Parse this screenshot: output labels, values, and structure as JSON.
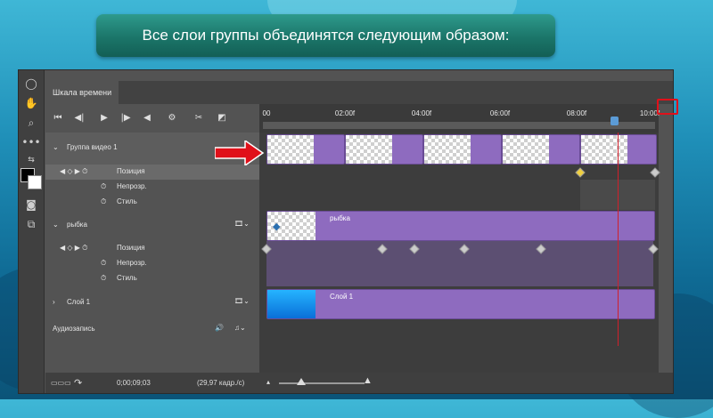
{
  "banner": {
    "text": "Все слои группы объединятся следующим образом:"
  },
  "timeline": {
    "tab_title": "Шкала времени",
    "ruler_labels": [
      "00",
      "02:00f",
      "04:00f",
      "06:00f",
      "08:00f",
      "10:00f"
    ],
    "layers": [
      {
        "name": "Группа видео 1",
        "props": [
          "Позиция",
          "Непрозр.",
          "Стиль"
        ]
      },
      {
        "name": "рыбка",
        "props": [
          "Позиция",
          "Непрозр.",
          "Стиль"
        ],
        "clip_label": "рыбка"
      },
      {
        "name": "Слой 1",
        "clip_label": "Слой 1"
      }
    ],
    "audio_label": "Аудиозапись",
    "timecode": "0;00;09;03",
    "fps": "(29,97 кадр./с)"
  },
  "colors": {
    "clip": "#8e6bbf",
    "playhead": "#d0202b",
    "arrow": "#e0101a",
    "highlight": "#e0101a"
  }
}
